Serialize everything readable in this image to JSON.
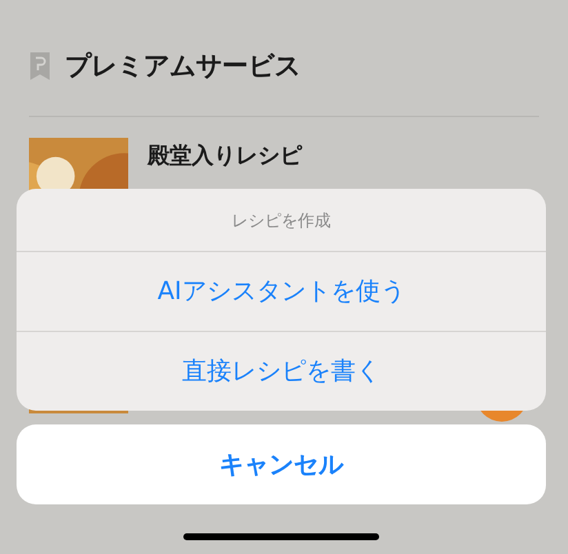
{
  "section": {
    "title": "プレミアムサービス"
  },
  "recipe": {
    "title": "殿堂入りレシピ"
  },
  "action_sheet": {
    "title": "レシピを作成",
    "actions": [
      "AIアシスタントを使う",
      "直接レシピを書く"
    ],
    "cancel": "キャンセル"
  }
}
